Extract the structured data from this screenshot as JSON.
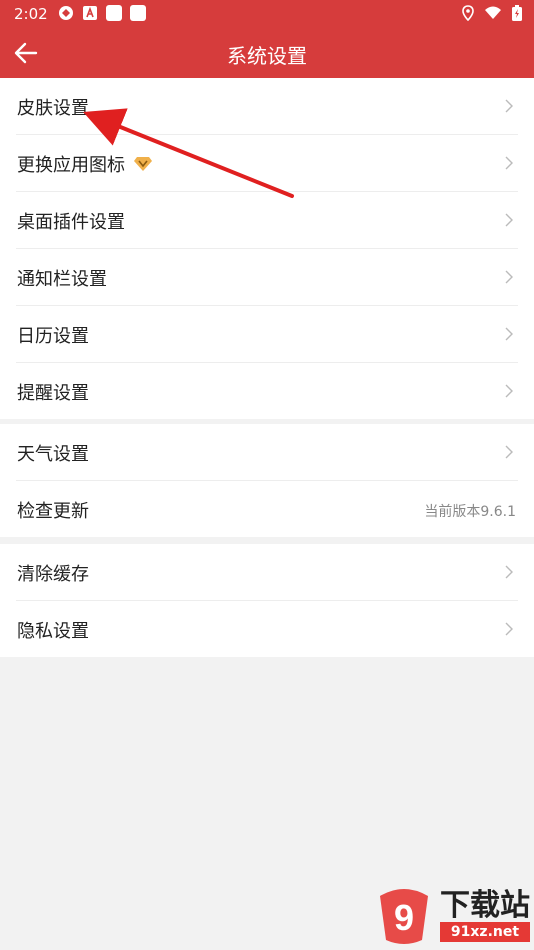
{
  "status": {
    "time": "2:02"
  },
  "header": {
    "title": "系统设置"
  },
  "group1": [
    {
      "label": "皮肤设置"
    },
    {
      "label": "更换应用图标"
    },
    {
      "label": "桌面插件设置"
    },
    {
      "label": "通知栏设置"
    },
    {
      "label": "日历设置"
    },
    {
      "label": "提醒设置"
    }
  ],
  "group2": [
    {
      "label": "天气设置"
    },
    {
      "label": "检查更新",
      "value": "当前版本9.6.1"
    }
  ],
  "group3": [
    {
      "label": "清除缓存"
    },
    {
      "label": "隐私设置"
    }
  ],
  "watermark": {
    "logo_text": "9",
    "big": "下载站",
    "small": "91xz.net"
  },
  "colors": {
    "accent": "#d63c3c",
    "arrow": "#e02020",
    "vip": "#f0b04a"
  }
}
